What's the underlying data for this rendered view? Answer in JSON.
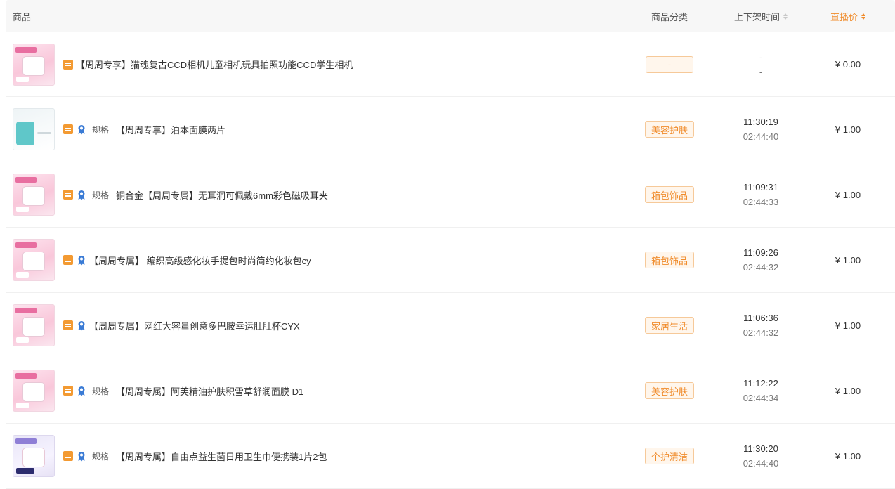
{
  "header": {
    "product": "商品",
    "category": "商品分类",
    "time": "上下架时间",
    "price": "直播价"
  },
  "rows": [
    {
      "thumb": "pink",
      "show_medal": false,
      "spec": "",
      "title": "【周周专享】猫魂复古CCD相机儿童相机玩具拍照功能CCD学生相机",
      "category": "-",
      "time_up": "-",
      "time_down": "-",
      "price": "¥ 0.00"
    },
    {
      "thumb": "blue",
      "show_medal": true,
      "spec": "规格",
      "title": "【周周专享】泊本面膜两片",
      "category": "美容护肤",
      "time_up": "11:30:19",
      "time_down": "02:44:40",
      "price": "¥ 1.00"
    },
    {
      "thumb": "pink",
      "show_medal": true,
      "spec": "规格",
      "title": "铜合金【周周专属】无耳洞可佩戴6mm彩色磁吸耳夹",
      "category": "箱包饰品",
      "time_up": "11:09:31",
      "time_down": "02:44:33",
      "price": "¥ 1.00"
    },
    {
      "thumb": "pink",
      "show_medal": true,
      "spec": "",
      "title": "【周周专属】 编织高级感化妆手提包时尚简约化妆包cy",
      "category": "箱包饰品",
      "time_up": "11:09:26",
      "time_down": "02:44:32",
      "price": "¥ 1.00"
    },
    {
      "thumb": "pink",
      "show_medal": true,
      "spec": "",
      "title": "【周周专属】网红大容量创意多巴胺幸运肚肚杯CYX",
      "category": "家居生活",
      "time_up": "11:06:36",
      "time_down": "02:44:32",
      "price": "¥ 1.00"
    },
    {
      "thumb": "pink",
      "show_medal": true,
      "spec": "规格",
      "title": "【周周专属】阿芙精油护肤积雪草舒润面膜 D1",
      "category": "美容护肤",
      "time_up": "11:12:22",
      "time_down": "02:44:34",
      "price": "¥ 1.00"
    },
    {
      "thumb": "purple",
      "show_medal": true,
      "spec": "规格",
      "title": "【周周专属】自由点益生菌日用卫生巾便携装1片2包",
      "category": "个护清洁",
      "time_up": "11:30:20",
      "time_down": "02:44:40",
      "price": "¥ 1.00"
    }
  ],
  "colors": {
    "accent": "#f08c2c",
    "tag_bg": "#fff6ec",
    "tag_border": "#f6c999",
    "doc_icon": "#f39a32",
    "medal_icon": "#3a7bd5"
  },
  "icons": {
    "doc": "document-icon",
    "medal": "medal-icon",
    "sort": "sort-caret-icon"
  }
}
